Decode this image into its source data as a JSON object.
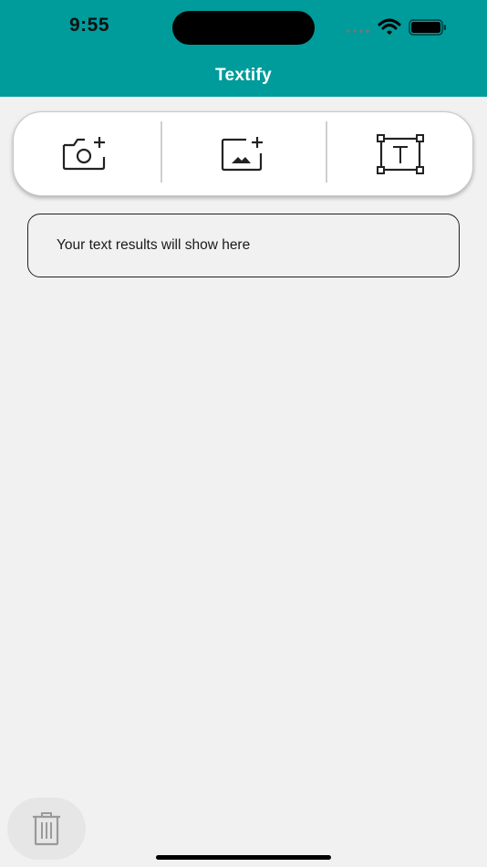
{
  "status_bar": {
    "time": "9:55"
  },
  "header": {
    "title": "Textify",
    "background_color": "#009b9b"
  },
  "toolbar": {
    "buttons": [
      {
        "name": "camera-add",
        "icon": "camera-plus-icon"
      },
      {
        "name": "gallery-add",
        "icon": "image-plus-icon"
      },
      {
        "name": "text-select",
        "icon": "text-box-icon"
      }
    ]
  },
  "results": {
    "placeholder_text": "Your text results will show here"
  },
  "footer": {
    "trash_icon": "trash-icon"
  }
}
